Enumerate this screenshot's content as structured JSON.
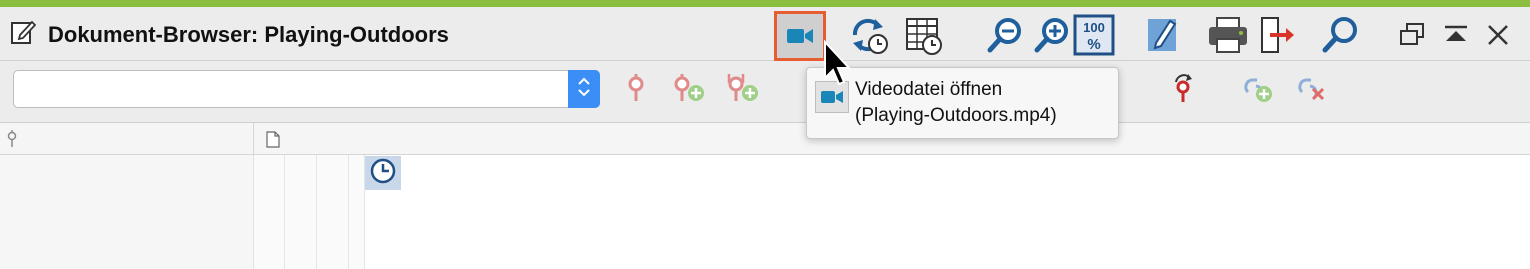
{
  "window": {
    "title": "Dokument-Browser: Playing-Outdoors",
    "accent_color": "#8cbf3f"
  },
  "toolbar": {
    "buttons": [
      {
        "name": "open-video",
        "icon": "video-camera-icon",
        "highlighted": true
      },
      {
        "name": "refresh-timestamps",
        "icon": "refresh-clock-icon"
      },
      {
        "name": "timestamp-table",
        "icon": "table-clock-icon"
      },
      {
        "name": "zoom-out",
        "icon": "zoom-out-icon"
      },
      {
        "name": "zoom-in",
        "icon": "zoom-in-icon"
      },
      {
        "name": "zoom-100",
        "icon": "zoom-100-icon"
      },
      {
        "name": "edit",
        "icon": "pencil-icon"
      },
      {
        "name": "print",
        "icon": "printer-icon"
      },
      {
        "name": "export",
        "icon": "export-icon"
      },
      {
        "name": "search",
        "icon": "search-icon"
      },
      {
        "name": "restore-window",
        "icon": "restore-window-icon"
      },
      {
        "name": "collapse",
        "icon": "collapse-icon"
      },
      {
        "name": "close",
        "icon": "close-icon"
      }
    ]
  },
  "filterbar": {
    "combo_value": "",
    "icons": [
      "code-pin-icon",
      "code-pin-add-icon",
      "code-pin-multi-add-icon",
      "code-pin-red-icon",
      "link-add-icon",
      "link-remove-icon"
    ]
  },
  "tooltip": {
    "line1": "Videodatei öffnen",
    "line2": "(Playing-Outdoors.mp4)"
  },
  "columns": {
    "left_icon": "code-pin-icon",
    "right_icon": "document-icon"
  }
}
